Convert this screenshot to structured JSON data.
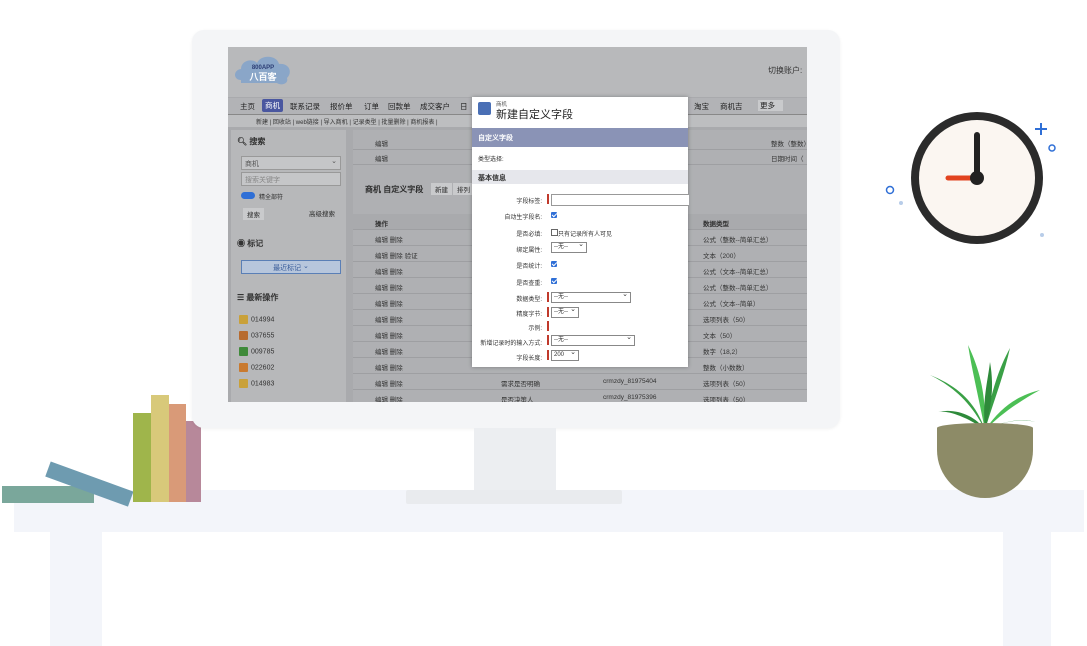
{
  "app": {
    "logo_text": "800APP",
    "logo_name": "八百客",
    "login_label": "切换账户:"
  },
  "nav": {
    "items": [
      "主页",
      "商机",
      "联系记录",
      "报价单",
      "订单",
      "回款单",
      "成交客户",
      "日"
    ],
    "active": "商机",
    "right_items": [
      "淘宝",
      "商机吉",
      "更多"
    ]
  },
  "subnav": "新建 | 回收站 | web链接 | 导入商机 | 记录类型 | 批量删除 | 商机报表 |",
  "sidebar": {
    "search_title": "搜索",
    "search_select": "商机",
    "search_placeholder": "搜索关键字",
    "search_toggle_label": "精全部符",
    "search_button": "搜索",
    "advanced_search": "高级搜索",
    "tags_title": "标记",
    "tags_select": "最近标记",
    "recent_title": "最新操作",
    "recent_items": [
      "014994",
      "037655",
      "009785",
      "022602",
      "014983"
    ]
  },
  "main": {
    "top_rows": [
      {
        "a": "编辑",
        "b": "整数（整数）"
      },
      {
        "a": "编辑",
        "b": "日期时间（"
      }
    ],
    "section_title": "商机 自定义字段",
    "section_buttons": [
      "新建",
      "排列"
    ],
    "col_action": "操作",
    "col_type": "数据类型",
    "rows": [
      {
        "action": "编辑 删除",
        "type": "公式（整数--简单汇总）"
      },
      {
        "action": "编辑 删除 验证",
        "type": "文本（200）"
      },
      {
        "action": "编辑 删除",
        "type": "公式（文本--简单汇总）"
      },
      {
        "action": "编辑 删除",
        "type": "公式（整数--简单汇总）"
      },
      {
        "action": "编辑 删除",
        "type": "公式（文本--简单）"
      },
      {
        "action": "编辑 删除",
        "type": "选项列表（50）"
      },
      {
        "action": "编辑 删除",
        "type": "文本（50）"
      },
      {
        "action": "编辑 删除",
        "type": "数字（18,2）"
      },
      {
        "action": "编辑 删除",
        "type": "整数（小数数）"
      },
      {
        "action": "编辑 删除",
        "name": "需求是否明确",
        "code": "crmzdy_81975404",
        "type": "选项列表（50）"
      },
      {
        "action": "编辑 删除",
        "name": "是否决策人",
        "code": "crmzdy_81975396",
        "type": "选项列表（50）"
      }
    ]
  },
  "dialog": {
    "subtitle": "商机",
    "title": "新建自定义字段",
    "section1": "自定义字段",
    "type_label": "类型选择:",
    "section2": "基本信息",
    "fields": {
      "display_name": "字段标签:",
      "auto_name": "自动生字段名:",
      "required": "是否必填:",
      "all_visible": "只有记录所有人可见",
      "relation": "绑定属性:",
      "relation_value": "--无--",
      "stats": "是否统计:",
      "unique": "是否查重:",
      "data_type": "数据类型:",
      "data_type_value": "--无--",
      "decimal": "精度字节:",
      "decimal_value": "--无--",
      "formula": "示例:",
      "input_mode": "新增记录时的输入方式:",
      "input_mode_value": "--无--",
      "length": "字段长度:",
      "length_value": "200"
    }
  },
  "colors": {
    "clock_hand_hour": "#222222",
    "clock_hand_minute": "#e2431f",
    "accent_blue": "#2f6fd6",
    "plant_green": "#3aa046",
    "pot": "#8d8b67"
  }
}
